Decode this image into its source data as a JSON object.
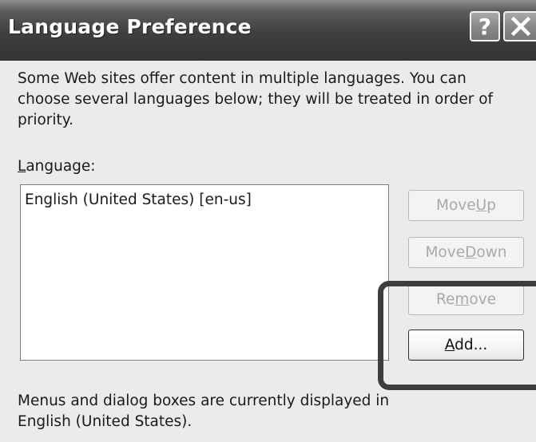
{
  "window": {
    "title": "Language Preference",
    "help_glyph": "?",
    "close_icon": "close-icon"
  },
  "intro_text": "Some Web sites offer content in multiple languages. You can choose several languages below; they will be treated in order of priority.",
  "language_label": {
    "mnemonic": "L",
    "rest": "anguage:"
  },
  "language_list": {
    "items": [
      "English (United States) [en-us]"
    ]
  },
  "buttons": {
    "move_up": {
      "pre": "Move ",
      "mnemonic": "U",
      "post": "p",
      "enabled": false
    },
    "move_down": {
      "pre": "Move ",
      "mnemonic": "D",
      "post": "own",
      "enabled": false
    },
    "remove": {
      "pre": "Re",
      "mnemonic": "m",
      "post": "ove",
      "enabled": false
    },
    "add": {
      "pre": "",
      "mnemonic": "A",
      "post": "dd...",
      "enabled": true
    }
  },
  "footer_text": "Menus and dialog boxes are currently displayed in English (United States).",
  "colors": {
    "title_bar": "#3f3f3f",
    "highlight_border": "#3d3d3d",
    "disabled_text": "#a9a9a7"
  }
}
